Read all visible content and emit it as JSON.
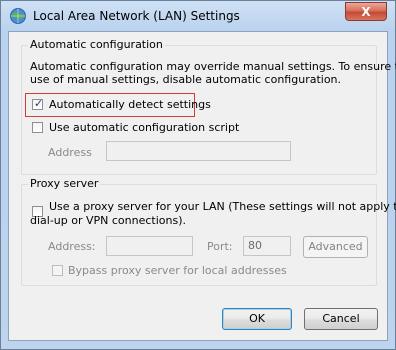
{
  "window": {
    "title": "Local Area Network (LAN) Settings",
    "close_glyph": "X"
  },
  "automatic_configuration": {
    "group_title": "Automatic configuration",
    "description_line1": "Automatic configuration may override manual settings.  To ensure the",
    "description_line2": "use of manual settings, disable automatic configuration.",
    "detect_settings": {
      "label": "Automatically detect settings",
      "checked": true
    },
    "use_script": {
      "label": "Use automatic configuration script",
      "checked": false
    },
    "address": {
      "label": "Address",
      "value": ""
    }
  },
  "proxy_server": {
    "group_title": "Proxy server",
    "use_proxy": {
      "label_line1": "Use a proxy server for your LAN (These settings will not apply to",
      "label_line2": "dial-up or VPN connections).",
      "checked": false
    },
    "address": {
      "label": "Address:",
      "value": ""
    },
    "port": {
      "label": "Port:",
      "value": "80"
    },
    "advanced_label": "Advanced",
    "bypass": {
      "label": "Bypass proxy server for local addresses",
      "checked": false
    }
  },
  "footer": {
    "ok_label": "OK",
    "cancel_label": "Cancel"
  },
  "colors": {
    "highlight_border": "#d33b3b",
    "close_button": "#c44a34"
  }
}
